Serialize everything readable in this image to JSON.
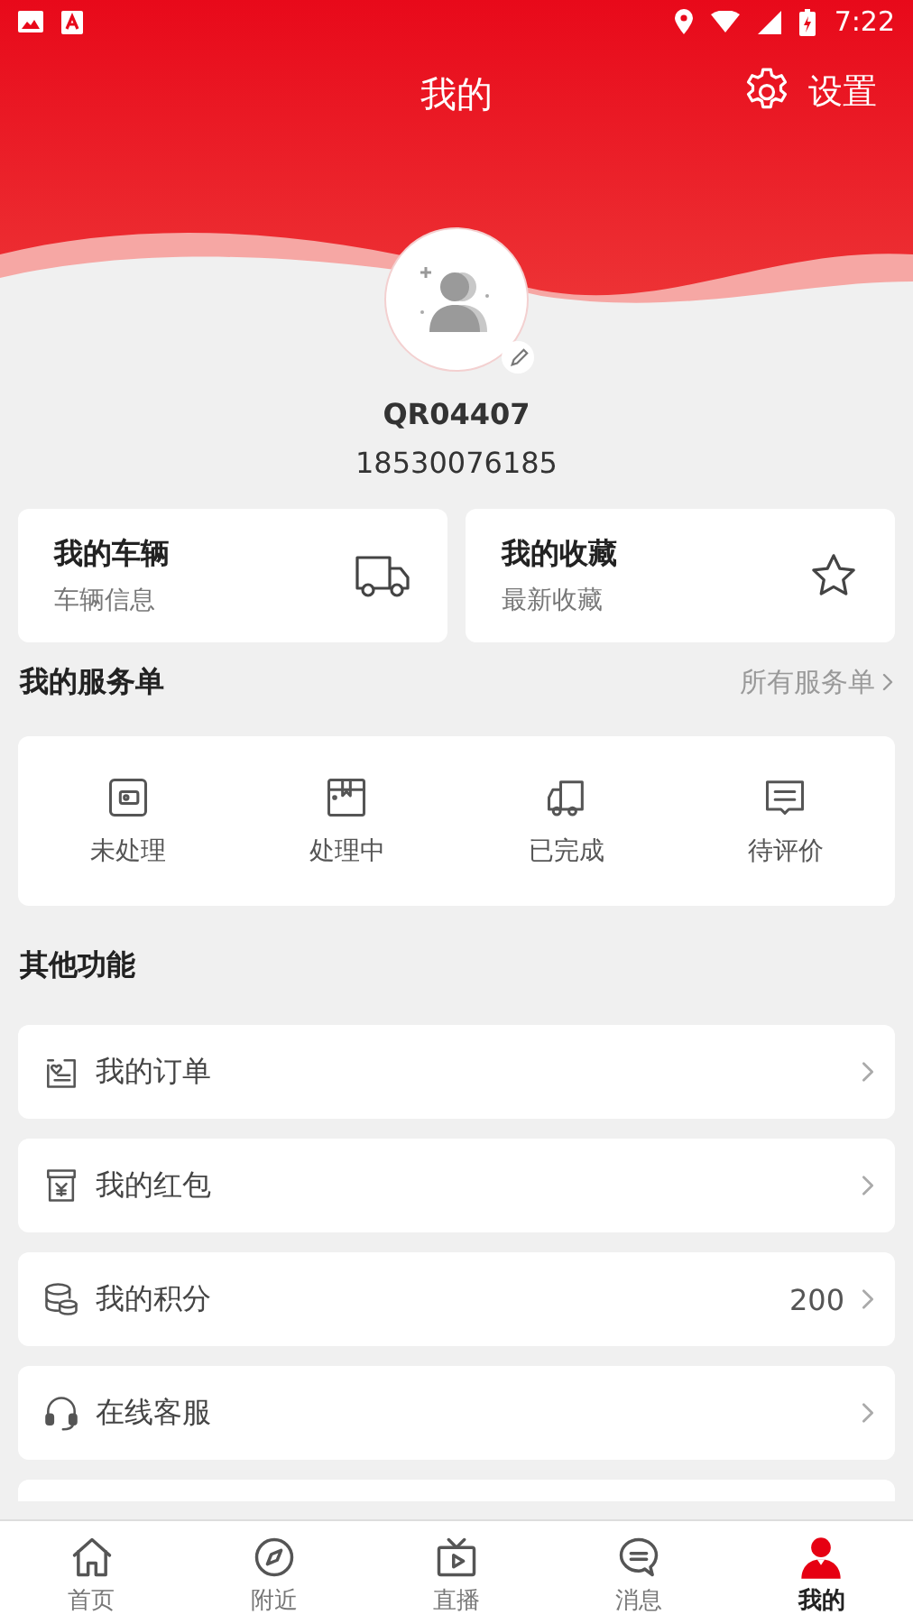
{
  "status_bar": {
    "time": "7:22"
  },
  "header": {
    "title": "我的",
    "action": "设置"
  },
  "profile": {
    "username": "QR04407",
    "phone": "18530076185"
  },
  "shortcuts": [
    {
      "title": "我的车辆",
      "subtitle": "车辆信息"
    },
    {
      "title": "我的收藏",
      "subtitle": "最新收藏"
    }
  ],
  "services": {
    "title": "我的服务单",
    "link": "所有服务单",
    "items": [
      {
        "label": "未处理"
      },
      {
        "label": "处理中"
      },
      {
        "label": "已完成"
      },
      {
        "label": "待评价"
      }
    ]
  },
  "other": {
    "title": "其他功能",
    "items": [
      {
        "label": "我的订单"
      },
      {
        "label": "我的红包"
      },
      {
        "label": "我的积分",
        "value": "200"
      },
      {
        "label": "在线客服"
      }
    ]
  },
  "tabs": [
    {
      "label": "首页",
      "selected": false
    },
    {
      "label": "附近",
      "selected": false
    },
    {
      "label": "直播",
      "selected": false
    },
    {
      "label": "消息",
      "selected": false
    },
    {
      "label": "我的",
      "selected": true
    }
  ]
}
